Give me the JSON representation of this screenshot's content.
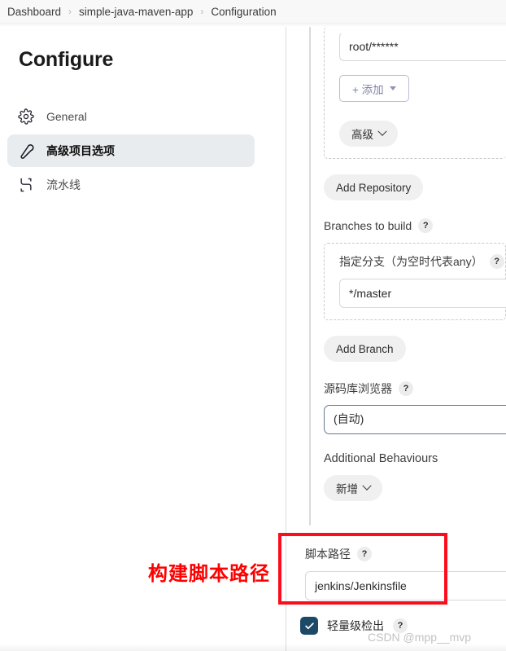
{
  "breadcrumb": {
    "items": [
      "Dashboard",
      "simple-java-maven-app",
      "Configuration"
    ],
    "separator": "›"
  },
  "sidebar": {
    "title": "Configure",
    "items": [
      {
        "label": "General",
        "icon": "gear-icon",
        "selected": false
      },
      {
        "label": "高级项目选项",
        "icon": "wrench-icon",
        "selected": true
      },
      {
        "label": "流水线",
        "icon": "pipeline-icon",
        "selected": false
      }
    ]
  },
  "form": {
    "credentials_value": "root/******",
    "add_credentials_label": "+ 添加",
    "advanced_label": "高级",
    "add_repository_label": "Add Repository",
    "branches_to_build_label": "Branches to build",
    "branch_specifier_label": "指定分支（为空时代表any）",
    "branch_specifier_value": "*/master",
    "add_branch_label": "Add Branch",
    "repository_browser_label": "源码库浏览器",
    "repository_browser_value": "(自动)",
    "additional_behaviours_label": "Additional Behaviours",
    "add_behaviour_label": "新增",
    "script_path_label": "脚本路径",
    "script_path_value": "jenkins/Jenkinsfile",
    "lightweight_checkout_label": "轻量级检出",
    "lightweight_checkout_checked": true,
    "help_glyph": "?"
  },
  "annotation": {
    "text": "构建脚本路径",
    "color": "#fe0000"
  },
  "watermark": {
    "text": "CSDN @mpp__mvp"
  },
  "colors": {
    "selected_nav_bg": "#e9ecef",
    "checkbox_fill": "#1c4966",
    "annotation_red": "#fe0000",
    "breadcrumb_bg": "#f8f8f8"
  }
}
